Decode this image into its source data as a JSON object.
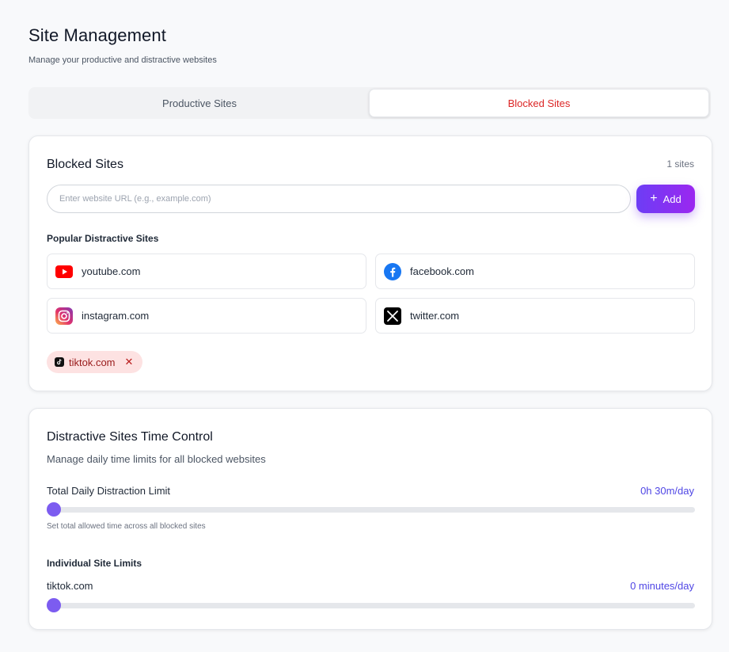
{
  "header": {
    "title": "Site Management",
    "subtitle": "Manage your productive and distractive websites"
  },
  "tabs": [
    {
      "label": "Productive Sites",
      "active": false
    },
    {
      "label": "Blocked Sites",
      "active": true
    }
  ],
  "blocked_card": {
    "title": "Blocked Sites",
    "count_label": "1 sites",
    "input_placeholder": "Enter website URL (e.g., example.com)",
    "input_value": "",
    "add_label": "Add",
    "popular_title": "Popular Distractive Sites",
    "popular_sites": [
      {
        "label": "youtube.com",
        "icon": "youtube-icon"
      },
      {
        "label": "facebook.com",
        "icon": "facebook-icon"
      },
      {
        "label": "instagram.com",
        "icon": "instagram-icon"
      },
      {
        "label": "twitter.com",
        "icon": "x-twitter-icon"
      }
    ],
    "blocked_sites": [
      {
        "label": "tiktok.com",
        "icon": "tiktok-icon",
        "remove": "✕"
      }
    ]
  },
  "time_card": {
    "title": "Distractive Sites Time Control",
    "subtitle": "Manage daily time limits for all blocked websites",
    "total_label": "Total Daily Distraction Limit",
    "total_value": "0h 30m/day",
    "total_slider_fraction": 0.0,
    "total_hint": "Set total allowed time across all blocked sites",
    "individual_title": "Individual Site Limits",
    "sites": [
      {
        "label": "tiktok.com",
        "value": "0 minutes/day",
        "slider_fraction": 0.0
      }
    ]
  },
  "colors": {
    "accent": "#7c3aed",
    "active_tab_text": "#dc2626",
    "chip_bg": "#fde2e2",
    "value_text": "#4f46e5"
  }
}
